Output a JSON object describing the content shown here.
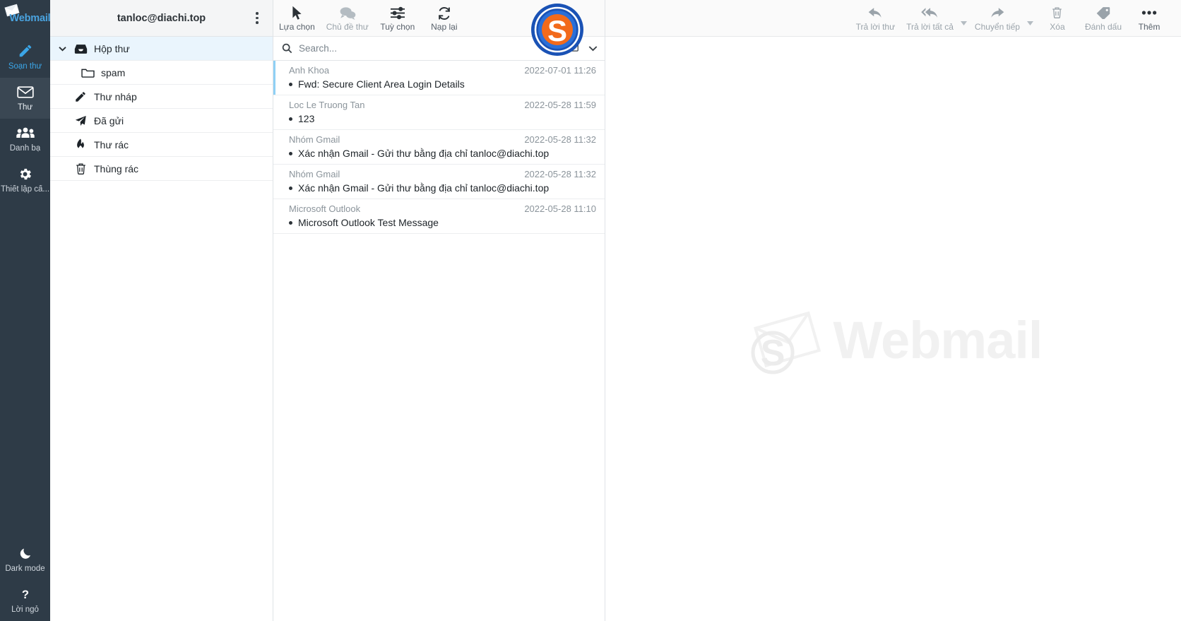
{
  "app": {
    "brand": "Webmail",
    "brand_badge": "S"
  },
  "rail": {
    "items": [
      {
        "label": "Soạn thư",
        "icon": "compose-icon",
        "state": "accent"
      },
      {
        "label": "Thư",
        "icon": "mail-icon",
        "state": "active"
      },
      {
        "label": "Danh bạ",
        "icon": "contacts-icon",
        "state": "normal"
      },
      {
        "label": "Thiết lập cấ...",
        "icon": "settings-gear-icon",
        "state": "normal"
      }
    ],
    "bottom_items": [
      {
        "label": "Dark mode",
        "icon": "moon-icon"
      },
      {
        "label": "Lời ngỏ",
        "icon": "question-mark-icon"
      }
    ]
  },
  "folders": {
    "account": "tanloc@diachi.top",
    "menu_icon": "kebab-menu-icon",
    "items": [
      {
        "label": "Hộp thư",
        "icon": "inbox-icon",
        "selected": true,
        "child": false,
        "caret": true
      },
      {
        "label": "spam",
        "icon": "folder-icon",
        "selected": false,
        "child": true,
        "caret": false
      },
      {
        "label": "Thư nháp",
        "icon": "pencil-icon",
        "selected": false,
        "child": false,
        "caret": false
      },
      {
        "label": "Đã gửi",
        "icon": "paper-plane-icon",
        "selected": false,
        "child": false,
        "caret": false
      },
      {
        "label": "Thư rác",
        "icon": "fire-icon",
        "selected": false,
        "child": false,
        "caret": false
      },
      {
        "label": "Thùng rác",
        "icon": "trash-icon",
        "selected": false,
        "child": false,
        "caret": false
      }
    ]
  },
  "search": {
    "placeholder": "Search...",
    "value": "",
    "icon": "search-icon",
    "scope_icon": "envelope-icon",
    "expand_icon": "chevron-down-icon"
  },
  "messages": [
    {
      "from": "Anh Khoa",
      "date": "2022-07-01 11:26",
      "subject": "Fwd: Secure Client Area Login Details",
      "selected": true,
      "unread": true
    },
    {
      "from": "Loc Le Truong Tan",
      "date": "2022-05-28 11:59",
      "subject": "123",
      "selected": false,
      "unread": true
    },
    {
      "from": "Nhóm Gmail",
      "date": "2022-05-28 11:32",
      "subject": "Xác nhận Gmail - Gửi thư bằng địa chỉ tanloc@diachi.top",
      "selected": false,
      "unread": true
    },
    {
      "from": "Nhóm Gmail",
      "date": "2022-05-28 11:32",
      "subject": "Xác nhận Gmail - Gửi thư bằng địa chỉ tanloc@diachi.top",
      "selected": false,
      "unread": true
    },
    {
      "from": "Microsoft Outlook",
      "date": "2022-05-28 11:10",
      "subject": "Microsoft Outlook Test Message",
      "selected": false,
      "unread": true
    }
  ],
  "list_toolbar": [
    {
      "label": "Lựa chọn",
      "icon": "cursor-arrow-icon",
      "enabled": true
    },
    {
      "label": "Chủ đề thư",
      "icon": "conversation-bubbles-icon",
      "enabled": false
    },
    {
      "label": "Tuỳ chọn",
      "icon": "sliders-icon",
      "enabled": true
    },
    {
      "label": "Nạp lại",
      "icon": "refresh-icon",
      "enabled": true
    }
  ],
  "message_toolbar": [
    {
      "label": "Trả lời thư",
      "icon": "reply-icon",
      "enabled": false,
      "caret": false
    },
    {
      "label": "Trả lời tất cả",
      "icon": "reply-all-icon",
      "enabled": false,
      "caret": true
    },
    {
      "label": "Chuyển tiếp",
      "icon": "forward-icon",
      "enabled": false,
      "caret": true
    },
    {
      "label": "Xóa",
      "icon": "trash-icon",
      "enabled": false,
      "caret": false
    },
    {
      "label": "Đánh dấu",
      "icon": "tag-icon",
      "enabled": false,
      "caret": false
    },
    {
      "label": "Thêm",
      "icon": "more-dots-icon",
      "enabled": true,
      "caret": false
    }
  ],
  "reading_pane": {
    "watermark_text": "Webmail",
    "watermark_icon": "webmail-logo-watermark"
  },
  "colors": {
    "rail_bg": "#2e3b47",
    "rail_active": "#3a4753",
    "accent_blue": "#3ba6e8",
    "selected_row": "#eaf5fd",
    "brand_orange": "#f06000",
    "brand_blue": "#1e4d8c"
  }
}
